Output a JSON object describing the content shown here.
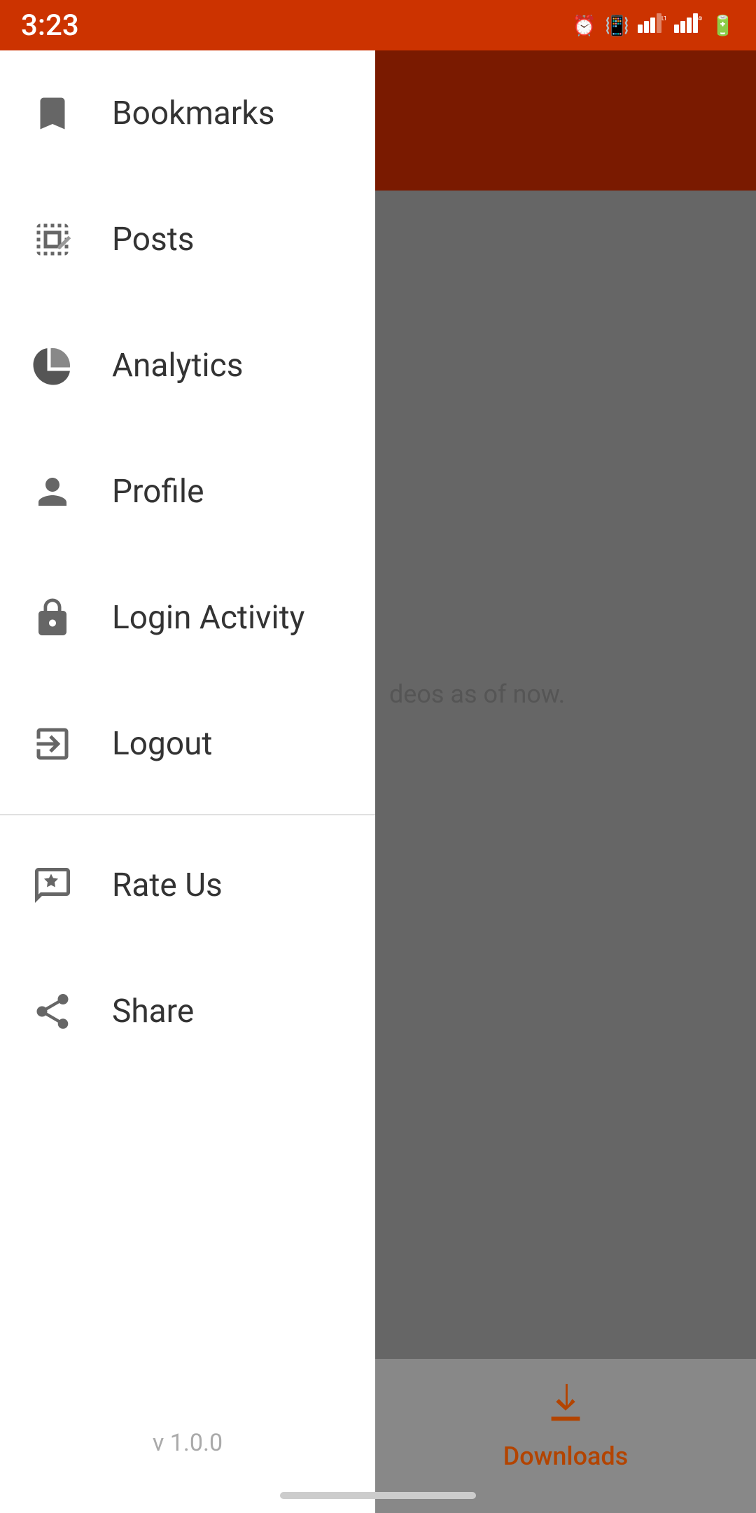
{
  "statusBar": {
    "time": "3:23"
  },
  "drawer": {
    "items": [
      {
        "id": "bookmarks",
        "label": "Bookmarks",
        "icon": "bookmark"
      },
      {
        "id": "posts",
        "label": "Posts",
        "icon": "posts"
      },
      {
        "id": "analytics",
        "label": "Analytics",
        "icon": "analytics"
      },
      {
        "id": "profile",
        "label": "Profile",
        "icon": "profile"
      },
      {
        "id": "login-activity",
        "label": "Login Activity",
        "icon": "lock"
      },
      {
        "id": "logout",
        "label": "Logout",
        "icon": "logout"
      }
    ],
    "secondaryItems": [
      {
        "id": "rate-us",
        "label": "Rate Us",
        "icon": "rate"
      },
      {
        "id": "share",
        "label": "Share",
        "icon": "share"
      }
    ],
    "version": "v 1.0.0"
  },
  "background": {
    "bodyText": "deos as of now."
  },
  "downloads": {
    "label": "Downloads"
  }
}
